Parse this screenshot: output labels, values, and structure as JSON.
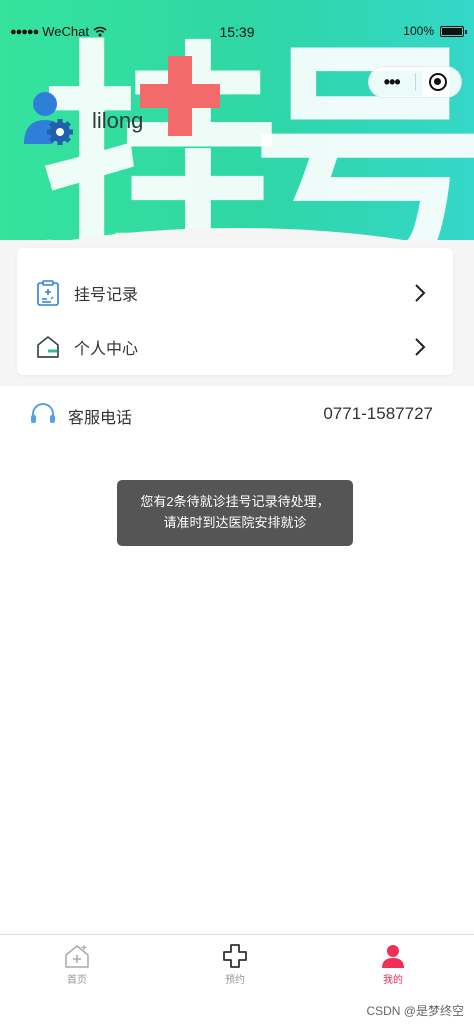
{
  "status_bar": {
    "carrier": "WeChat",
    "time": "15:39",
    "battery": "100%"
  },
  "header": {
    "banner_text_1": "挂",
    "banner_text_2": "号",
    "username": "lilong"
  },
  "menu": {
    "items": [
      {
        "label": "挂号记录",
        "icon": "clipboard-icon"
      },
      {
        "label": "个人中心",
        "icon": "home-icon"
      }
    ]
  },
  "service": {
    "label": "客服电话",
    "phone": "0771-1587727",
    "icon": "headset-icon"
  },
  "toast": {
    "message": "您有2条待就诊挂号记录待处理，请准时到达医院安排就诊"
  },
  "tabbar": {
    "tabs": [
      {
        "label": "首页",
        "icon": "home-plus-icon",
        "active": false
      },
      {
        "label": "预约",
        "icon": "cross-icon",
        "active": false
      },
      {
        "label": "我的",
        "icon": "user-icon",
        "active": true
      }
    ]
  },
  "watermark": "CSDN @是梦终空",
  "colors": {
    "header_green": "#35e39c",
    "header_teal": "#34d7c9",
    "accent_red": "#f26a6a",
    "active_tab": "#ef2f55",
    "icon_blue": "#2f7fd9"
  }
}
